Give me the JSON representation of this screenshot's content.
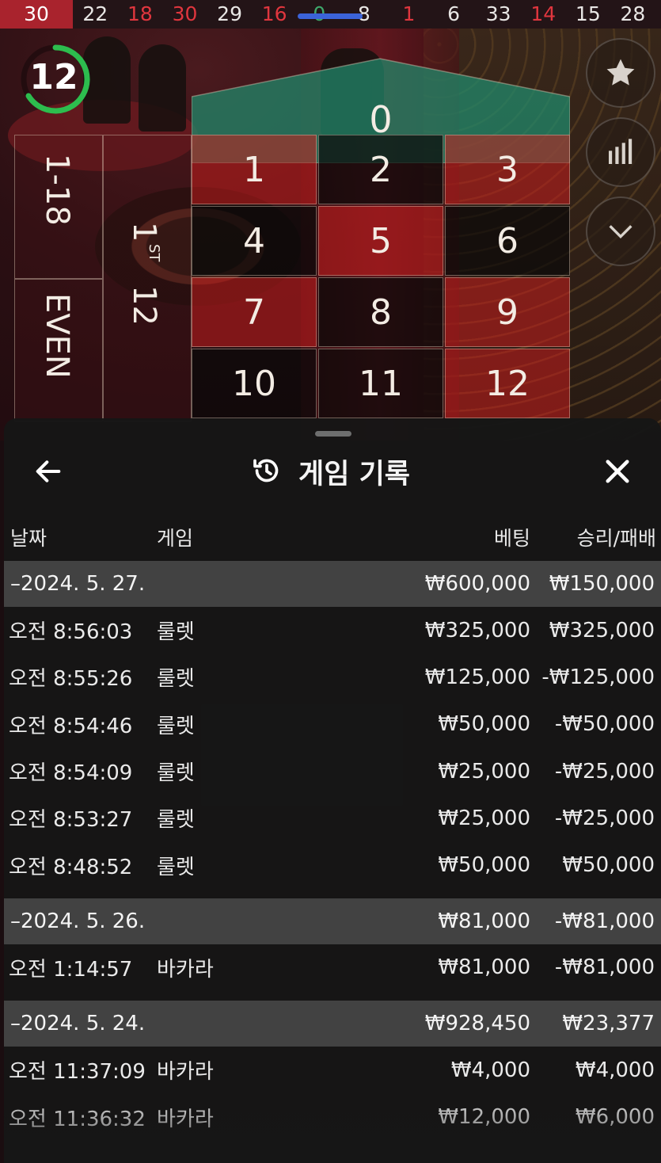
{
  "recent_results": [
    {
      "value": "30",
      "color": "red"
    },
    {
      "value": "22",
      "color": "black"
    },
    {
      "value": "18",
      "color": "red"
    },
    {
      "value": "30",
      "color": "red"
    },
    {
      "value": "29",
      "color": "black"
    },
    {
      "value": "16",
      "color": "red"
    },
    {
      "value": "0",
      "color": "green"
    },
    {
      "value": "8",
      "color": "black"
    },
    {
      "value": "1",
      "color": "red"
    },
    {
      "value": "6",
      "color": "black"
    },
    {
      "value": "33",
      "color": "black"
    },
    {
      "value": "14",
      "color": "red"
    },
    {
      "value": "15",
      "color": "black"
    },
    {
      "value": "28",
      "color": "black"
    }
  ],
  "timer": {
    "seconds": "12"
  },
  "side_buttons": [
    "star-icon",
    "stats-icon",
    "chevron-down-icon"
  ],
  "board": {
    "zero": "0",
    "numbers": [
      {
        "n": "1",
        "color": "red"
      },
      {
        "n": "2",
        "color": "black"
      },
      {
        "n": "3",
        "color": "red"
      },
      {
        "n": "4",
        "color": "black"
      },
      {
        "n": "5",
        "color": "red"
      },
      {
        "n": "6",
        "color": "black"
      },
      {
        "n": "7",
        "color": "red"
      },
      {
        "n": "8",
        "color": "black"
      },
      {
        "n": "9",
        "color": "red"
      },
      {
        "n": "10",
        "color": "black"
      },
      {
        "n": "11",
        "color": "black"
      },
      {
        "n": "12",
        "color": "red"
      }
    ],
    "low_label": "1-18",
    "even_label": "EVEN",
    "dozen_number": "1",
    "dozen_suffix": "ST",
    "dozen_twelve": "12"
  },
  "panel": {
    "title": "게임 기록",
    "columns": {
      "date": "날짜",
      "game": "게임",
      "bet": "베팅",
      "result": "승리/패배"
    }
  },
  "history": [
    {
      "date": "–2024. 5. 27.",
      "bet": "₩600,000",
      "result": "₩150,000",
      "rows": [
        {
          "time": "오전 8:56:03",
          "game": "룰렛",
          "bet": "₩325,000",
          "result": "₩325,000"
        },
        {
          "time": "오전 8:55:26",
          "game": "룰렛",
          "bet": "₩125,000",
          "result": "-₩125,000"
        },
        {
          "time": "오전 8:54:46",
          "game": "룰렛",
          "bet": "₩50,000",
          "result": "-₩50,000"
        },
        {
          "time": "오전 8:54:09",
          "game": "룰렛",
          "bet": "₩25,000",
          "result": "-₩25,000"
        },
        {
          "time": "오전 8:53:27",
          "game": "룰렛",
          "bet": "₩25,000",
          "result": "-₩25,000"
        },
        {
          "time": "오전 8:48:52",
          "game": "룰렛",
          "bet": "₩50,000",
          "result": "₩50,000"
        }
      ]
    },
    {
      "date": "–2024. 5. 26.",
      "bet": "₩81,000",
      "result": "-₩81,000",
      "rows": [
        {
          "time": "오전 1:14:57",
          "game": "바카라",
          "bet": "₩81,000",
          "result": "-₩81,000"
        }
      ]
    },
    {
      "date": "–2024. 5. 24.",
      "bet": "₩928,450",
      "result": "₩23,377",
      "rows": [
        {
          "time": "오전 11:37:09",
          "game": "바카라",
          "bet": "₩4,000",
          "result": "₩4,000"
        },
        {
          "time": "오전 11:36:32",
          "game": "바카라",
          "bet": "₩12,000",
          "result": "₩6,000"
        }
      ]
    }
  ]
}
